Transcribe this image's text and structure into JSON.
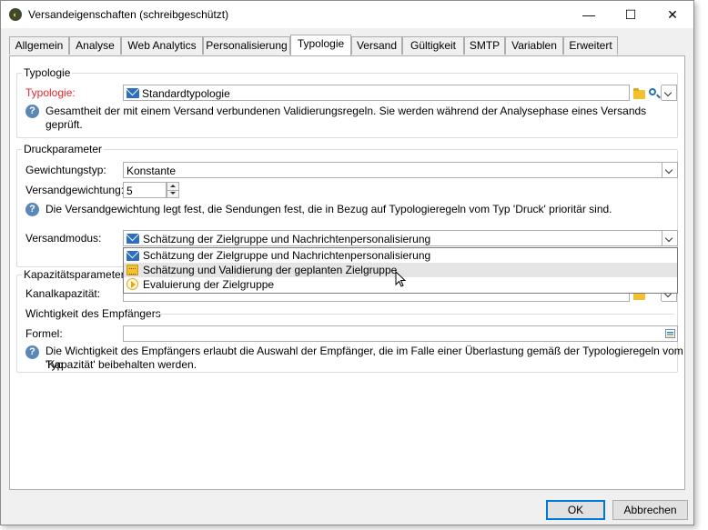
{
  "window": {
    "title": "Versandeigenschaften (schreibgeschützt)",
    "minimize_glyph": "—",
    "maximize_glyph": "☐",
    "close_glyph": "✕"
  },
  "tabs": [
    {
      "label": "Allgemein"
    },
    {
      "label": "Analyse"
    },
    {
      "label": "Web Analytics"
    },
    {
      "label": "Personalisierung"
    },
    {
      "label": "Typologie",
      "active": true
    },
    {
      "label": "Versand"
    },
    {
      "label": "Gültigkeit"
    },
    {
      "label": "SMTP"
    },
    {
      "label": "Variablen"
    },
    {
      "label": "Erweitert"
    }
  ],
  "typology": {
    "group_title": "Typologie",
    "label": "Typologie:",
    "value": "Standardtypologie",
    "info": "Gesamtheit der mit einem Versand verbundenen Validierungsregeln. Sie werden während der Analysephase eines Versands geprüft."
  },
  "print": {
    "group_title": "Druckparameter",
    "weight_type_label": "Gewichtungstyp:",
    "weight_type_value": "Konstante",
    "weight_label": "Versandgewichtung:",
    "weight_value": "5",
    "info": "Die Versandgewichtung legt fest, die Sendungen fest, die in Bezug auf Typologieregeln vom Typ 'Druck' prioritär sind.",
    "mode_label": "Versandmodus:",
    "mode_value": "Schätzung der Zielgruppe und Nachrichtenpersonalisierung"
  },
  "mode_options": [
    {
      "label": "Schätzung der Zielgruppe und Nachrichtenpersonalisierung",
      "icon": "envelope-icon"
    },
    {
      "label": "Schätzung und Validierung der geplanten Zielgruppe",
      "icon": "calendar-icon"
    },
    {
      "label": "Evaluierung der Zielgruppe",
      "icon": "play-icon"
    }
  ],
  "capacity": {
    "group_title": "Kapazitätsparameter",
    "channel_label": "Kanalkapazität:",
    "recipient_title": "Wichtigkeit des Empfängers",
    "formula_label": "Formel:",
    "formula_value": "",
    "info_line1": "Die Wichtigkeit des Empfängers erlaubt die Auswahl der Empfänger, die im Falle einer Überlastung gemäß der Typologieregeln vom Typ",
    "info_line2": "'Kapazität' beibehalten werden."
  },
  "buttons": {
    "ok": "OK",
    "cancel": "Abbrechen"
  },
  "colors": {
    "required_label": "#e8262b",
    "info_icon": "#5a87b8",
    "default_button_border": "#0078d7"
  }
}
